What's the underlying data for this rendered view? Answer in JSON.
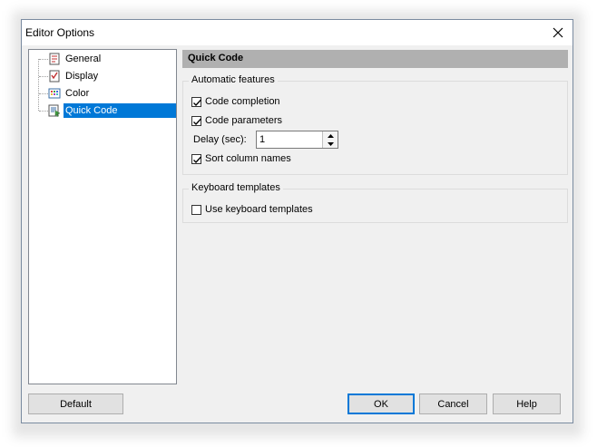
{
  "window": {
    "title": "Editor Options"
  },
  "tree": {
    "items": [
      {
        "label": "General",
        "icon": "general-page-icon"
      },
      {
        "label": "Display",
        "icon": "display-page-icon"
      },
      {
        "label": "Color",
        "icon": "color-grid-icon"
      },
      {
        "label": "Quick Code",
        "icon": "quick-code-icon",
        "selected": true
      }
    ]
  },
  "section": {
    "title": "Quick Code"
  },
  "automatic": {
    "title": "Automatic features",
    "code_completion": {
      "label": "Code completion",
      "checked": true
    },
    "code_parameters": {
      "label": "Code parameters",
      "checked": true
    },
    "delay": {
      "label": "Delay (sec):",
      "value": "1"
    },
    "sort_column_names": {
      "label": "Sort column names",
      "checked": true
    }
  },
  "keyboard": {
    "title": "Keyboard templates",
    "use_templates": {
      "label": "Use keyboard templates",
      "checked": false
    }
  },
  "buttons": {
    "default": "Default",
    "ok": "OK",
    "cancel": "Cancel",
    "help": "Help"
  },
  "colors": {
    "selection": "#0078d7",
    "header": "#b0b0b0",
    "window_bg": "#f0f0f0"
  }
}
